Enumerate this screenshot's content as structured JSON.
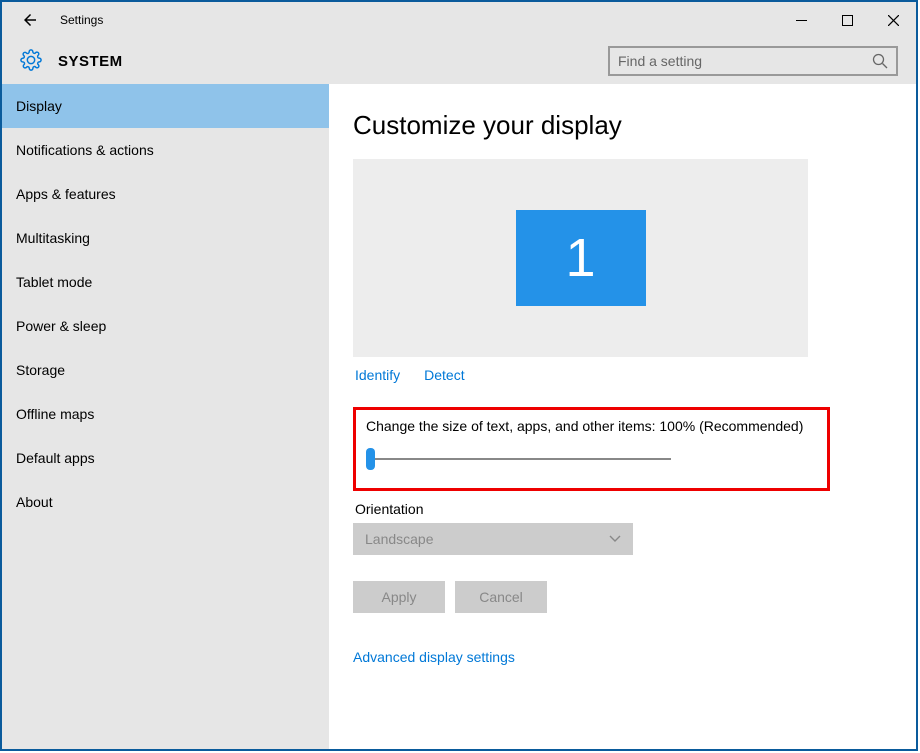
{
  "window": {
    "title": "Settings"
  },
  "header": {
    "system_label": "SYSTEM",
    "search_placeholder": "Find a setting"
  },
  "sidebar": {
    "items": [
      {
        "label": "Display",
        "active": true
      },
      {
        "label": "Notifications & actions",
        "active": false
      },
      {
        "label": "Apps & features",
        "active": false
      },
      {
        "label": "Multitasking",
        "active": false
      },
      {
        "label": "Tablet mode",
        "active": false
      },
      {
        "label": "Power & sleep",
        "active": false
      },
      {
        "label": "Storage",
        "active": false
      },
      {
        "label": "Offline maps",
        "active": false
      },
      {
        "label": "Default apps",
        "active": false
      },
      {
        "label": "About",
        "active": false
      }
    ]
  },
  "content": {
    "page_title": "Customize your display",
    "monitor_number": "1",
    "identify_link": "Identify",
    "detect_link": "Detect",
    "scale_label": "Change the size of text, apps, and other items: 100% (Recommended)",
    "orientation_label": "Orientation",
    "orientation_value": "Landscape",
    "apply_btn": "Apply",
    "cancel_btn": "Cancel",
    "advanced_link": "Advanced display settings"
  }
}
